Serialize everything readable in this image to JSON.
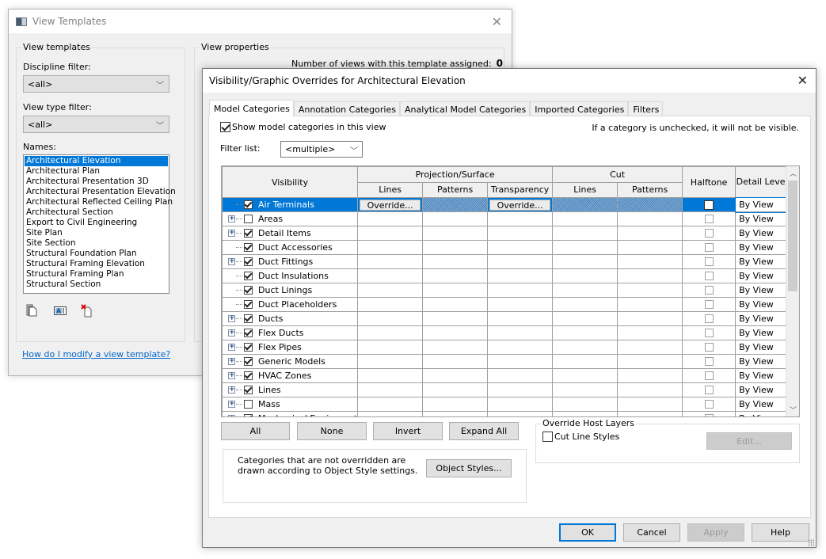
{
  "view_templates": {
    "title": "View Templates",
    "left_group": "View templates",
    "discipline_filter_label": "Discipline filter:",
    "discipline_filter_value": "<all>",
    "view_type_filter_label": "View type filter:",
    "view_type_filter_value": "<all>",
    "names_label": "Names:",
    "names": [
      "Architectural Elevation",
      "Architectural Plan",
      "Architectural Presentation 3D",
      "Architectural Presentation Elevation",
      "Architectural Reflected Ceiling Plan",
      "Architectural Section",
      "Export to Civil Engineering",
      "Site Plan",
      "Site Section",
      "Structural Foundation Plan",
      "Structural Framing Elevation",
      "Structural Framing Plan",
      "Structural Section"
    ],
    "selected_name": "Architectural Elevation",
    "toolbar_icons": [
      "duplicate-icon",
      "rename-icon",
      "delete-icon"
    ],
    "help_link": "How do I modify a view template?",
    "right_group": "View properties",
    "num_views_label": "Number of views with this template assigned:",
    "num_views_value": "0"
  },
  "vg_dialog": {
    "title": "Visibility/Graphic Overrides for Architectural Elevation",
    "tabs": [
      {
        "label": "Model Categories",
        "active": true
      },
      {
        "label": "Annotation Categories",
        "active": false
      },
      {
        "label": "Analytical Model Categories",
        "active": false
      },
      {
        "label": "Imported Categories",
        "active": false
      },
      {
        "label": "Filters",
        "active": false
      }
    ],
    "show_categories_label": "Show model categories in this view",
    "show_categories_checked": true,
    "hint": "If a category is unchecked, it will not be visible.",
    "filter_list_label": "Filter list:",
    "filter_list_value": "<multiple>",
    "grid": {
      "headers": {
        "visibility": "Visibility",
        "projection_surface": "Projection/Surface",
        "cut": "Cut",
        "halftone": "Halftone",
        "detail_level": "Detail Level",
        "lines": "Lines",
        "patterns": "Patterns",
        "transparency": "Transparency",
        "cut_lines": "Lines",
        "cut_patterns": "Patterns"
      },
      "override_label": "Override...",
      "rows": [
        {
          "name": "Air Terminals",
          "checked": true,
          "expandable": false,
          "selected": true,
          "cells": [
            "override",
            "hatch",
            "override",
            "hatch",
            "hatch"
          ],
          "halftone": false,
          "detail": "By View"
        },
        {
          "name": "Areas",
          "checked": false,
          "expandable": true,
          "cells": [
            "hatch",
            "hatch",
            "hatch",
            "hatch",
            "hatch"
          ],
          "halftone": false,
          "detail": "By View"
        },
        {
          "name": "Detail Items",
          "checked": true,
          "expandable": true,
          "cells": [
            "",
            "",
            "",
            "hatch",
            "hatch"
          ],
          "halftone": false,
          "detail": "By View"
        },
        {
          "name": "Duct Accessories",
          "checked": true,
          "expandable": false,
          "cells": [
            "",
            "hatch",
            "",
            "hatch",
            "hatch"
          ],
          "halftone": false,
          "detail": "By View"
        },
        {
          "name": "Duct Fittings",
          "checked": true,
          "expandable": true,
          "cells": [
            "",
            "hatch",
            "",
            "hatch",
            "hatch"
          ],
          "halftone": false,
          "detail": "By View"
        },
        {
          "name": "Duct Insulations",
          "checked": true,
          "expandable": false,
          "cells": [
            "",
            "hatch",
            "",
            "hatch",
            "hatch"
          ],
          "halftone": false,
          "detail": "By View"
        },
        {
          "name": "Duct Linings",
          "checked": true,
          "expandable": false,
          "cells": [
            "",
            "hatch",
            "",
            "hatch",
            "hatch"
          ],
          "halftone": false,
          "detail": "By View"
        },
        {
          "name": "Duct Placeholders",
          "checked": true,
          "expandable": false,
          "cells": [
            "",
            "hatch",
            "hatch",
            "hatch",
            "hatch"
          ],
          "halftone": false,
          "detail": "By View"
        },
        {
          "name": "Ducts",
          "checked": true,
          "expandable": true,
          "cells": [
            "",
            "hatch",
            "",
            "hatch",
            "hatch"
          ],
          "halftone": false,
          "detail": "By View"
        },
        {
          "name": "Flex Ducts",
          "checked": true,
          "expandable": true,
          "cells": [
            "",
            "hatch",
            "",
            "hatch",
            "hatch"
          ],
          "halftone": false,
          "detail": "By View"
        },
        {
          "name": "Flex Pipes",
          "checked": true,
          "expandable": true,
          "cells": [
            "",
            "hatch",
            "",
            "hatch",
            "hatch"
          ],
          "halftone": false,
          "detail": "By View"
        },
        {
          "name": "Generic Models",
          "checked": true,
          "expandable": true,
          "cells": [
            "",
            "",
            "",
            "",
            ""
          ],
          "halftone": false,
          "detail": "By View"
        },
        {
          "name": "HVAC Zones",
          "checked": true,
          "expandable": true,
          "cells": [
            "",
            "hatch",
            "",
            "hatch",
            "hatch"
          ],
          "halftone": false,
          "detail": "By View"
        },
        {
          "name": "Lines",
          "checked": true,
          "expandable": true,
          "cells": [
            "",
            "hatch",
            "hatch",
            "hatch",
            "hatch"
          ],
          "halftone": false,
          "detail": "By View"
        },
        {
          "name": "Mass",
          "checked": false,
          "expandable": true,
          "cells": [
            "",
            "",
            "",
            "",
            ""
          ],
          "halftone": false,
          "detail": "By View"
        },
        {
          "name": "Mechanical Equipment",
          "checked": true,
          "expandable": true,
          "cells": [
            "",
            "",
            "",
            "hatch",
            "hatch"
          ],
          "halftone": false,
          "detail": "By View"
        }
      ]
    },
    "buttons": {
      "all": "All",
      "none": "None",
      "invert": "Invert",
      "expand_all": "Expand All",
      "object_styles": "Object Styles...",
      "edit": "Edit...",
      "ok": "OK",
      "cancel": "Cancel",
      "apply": "Apply",
      "help": "Help"
    },
    "note": "Categories that are not overridden are drawn according to Object Style settings.",
    "host_layers_group": "Override Host Layers",
    "cut_line_styles_label": "Cut Line Styles",
    "cut_line_styles_checked": false
  }
}
